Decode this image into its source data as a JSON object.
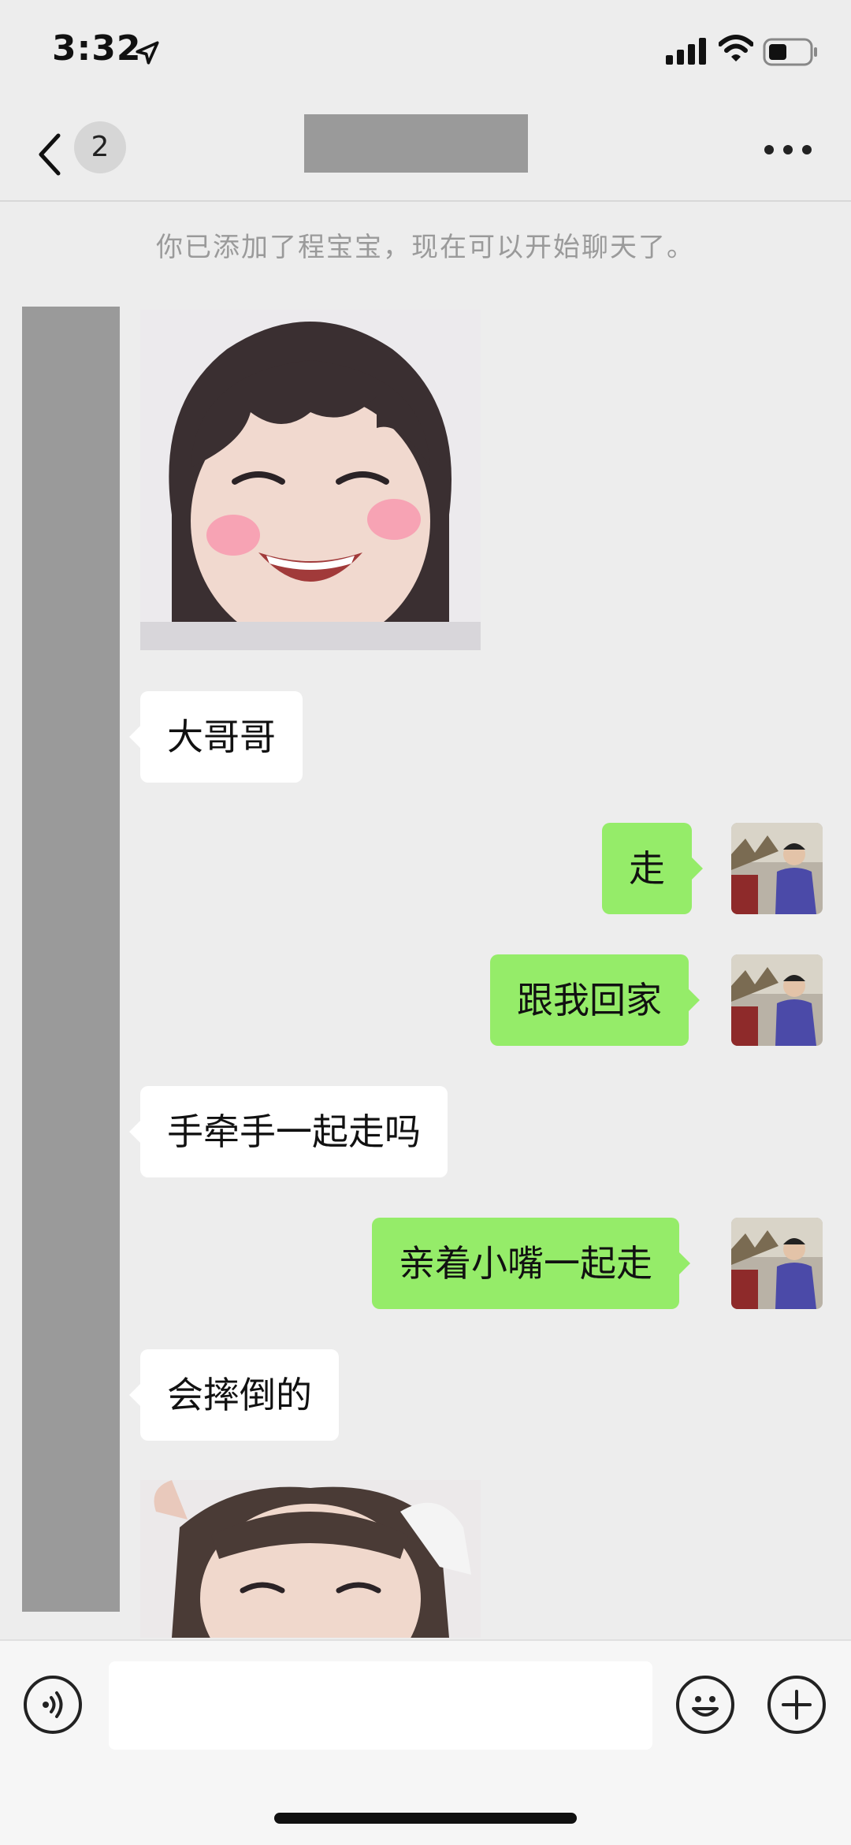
{
  "status_bar": {
    "time": "3:32"
  },
  "nav": {
    "unread_count": "2"
  },
  "system_message": "你已添加了程宝宝，现在可以开始聊天了。",
  "messages": [
    {
      "side": "in",
      "type": "image",
      "icon": "smiling-child-photo"
    },
    {
      "side": "in",
      "type": "text",
      "text": "大哥哥"
    },
    {
      "side": "out",
      "type": "text",
      "text": "走"
    },
    {
      "side": "out",
      "type": "text",
      "text": "跟我回家"
    },
    {
      "side": "in",
      "type": "text",
      "text": "手牵手一起走吗"
    },
    {
      "side": "out",
      "type": "text",
      "text": "亲着小嘴一起走"
    },
    {
      "side": "in",
      "type": "text",
      "text": "会摔倒的"
    },
    {
      "side": "in",
      "type": "image",
      "icon": "child-photo"
    }
  ],
  "colors": {
    "background": "#ededed",
    "outgoing_bubble": "#95ec69",
    "incoming_bubble": "#ffffff",
    "redaction": "#9a9a9a"
  },
  "icons": [
    "location-arrow-icon",
    "signal-icon",
    "wifi-icon",
    "battery-icon",
    "back-chevron-icon",
    "more-icon",
    "voice-icon",
    "emoji-icon",
    "plus-icon"
  ]
}
